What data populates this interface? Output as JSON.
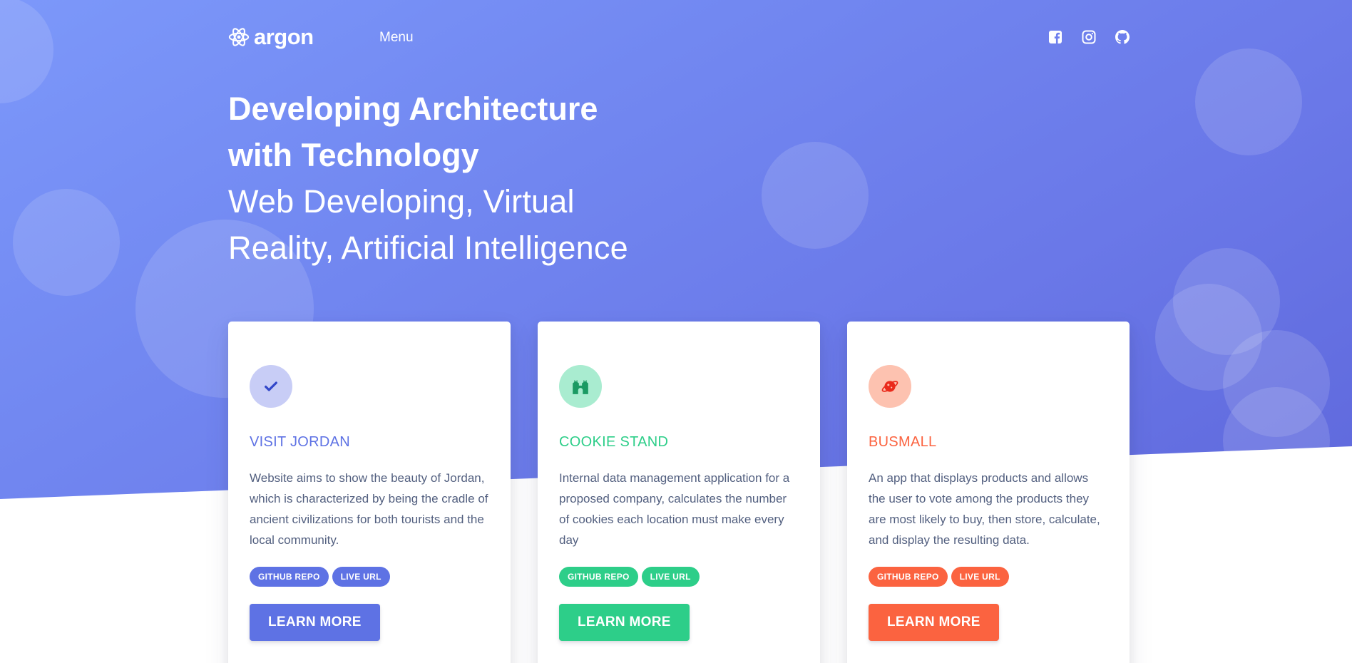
{
  "brand": {
    "name": "argon",
    "logo_icon": "atom-icon"
  },
  "nav": {
    "menu_label": "Menu",
    "social_icons": [
      "facebook-icon",
      "instagram-icon",
      "github-icon"
    ]
  },
  "hero": {
    "title": "Developing Architecture with Technology",
    "subtitle": "Web Developing, Virtual Reality, Artificial Intelligence"
  },
  "colors": {
    "primary": "#5e72e4",
    "success": "#2dce89",
    "warning": "#fb6340"
  },
  "cards": [
    {
      "title": "VISIT JORDAN",
      "icon": "check-icon",
      "description": "Website aims to show the beauty of Jordan, which is characterized by being the cradle of ancient civilizations for both tourists and the local community.",
      "badge_repo": "GITHUB REPO",
      "badge_live": "LIVE URL",
      "button": "LEARN MORE",
      "accent": "#5e72e4",
      "soft": "#c8cdf6"
    },
    {
      "title": "COOKIE STAND",
      "icon": "castle-icon",
      "description": "Internal data management application for a proposed company, calculates the number of cookies each location must make every day",
      "badge_repo": "GITHUB REPO",
      "badge_live": "LIVE URL",
      "button": "LEARN MORE",
      "accent": "#2dce89",
      "soft": "#a9ecd0"
    },
    {
      "title": "BUSMALL",
      "icon": "planet-icon",
      "description": "An app that displays products and allows the user to vote among the products they are most likely to buy, then store, calculate, and display the resulting data.",
      "badge_repo": "GITHUB REPO",
      "badge_live": "LIVE URL",
      "button": "LEARN MORE",
      "accent": "#fb6340",
      "soft": "#fdc2b0"
    }
  ]
}
